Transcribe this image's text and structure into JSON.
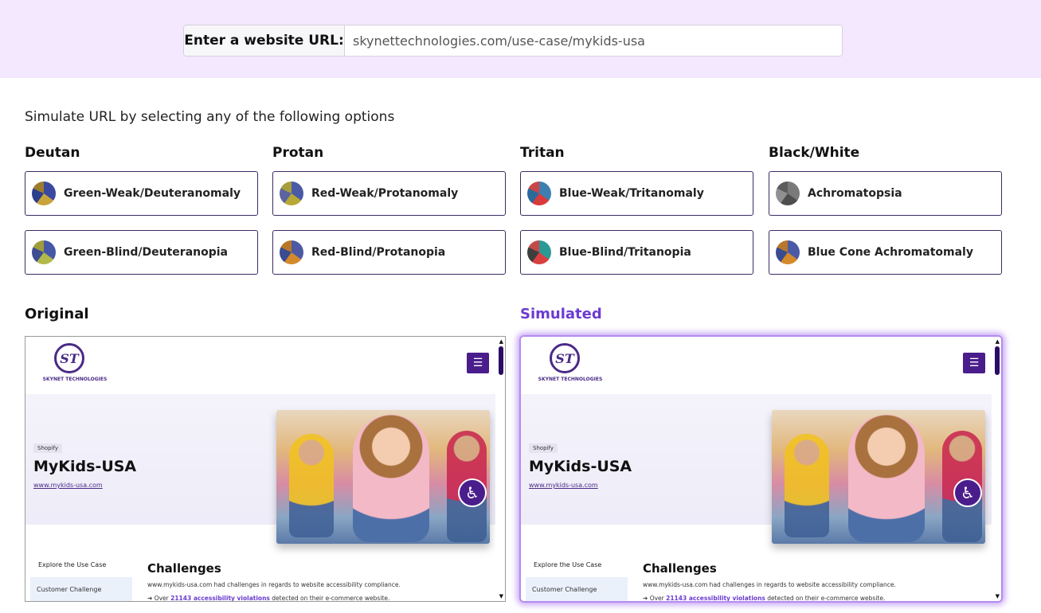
{
  "url_bar": {
    "label": "Enter a website URL:",
    "value": "skynettechnologies.com/use-case/mykids-usa"
  },
  "instructions": "Simulate URL by selecting any of the following options",
  "groups": [
    {
      "title": "Deutan",
      "options": [
        {
          "label": "Green-Weak/Deuteranomaly",
          "colors": [
            "#3b4aa0",
            "#c9a43a",
            "#2b3f8c",
            "#9d7c2e"
          ]
        },
        {
          "label": "Green-Blind/Deuteranopia",
          "colors": [
            "#4657a8",
            "#b3b84a",
            "#3c4d92",
            "#a09c3b"
          ]
        }
      ]
    },
    {
      "title": "Protan",
      "options": [
        {
          "label": "Red-Weak/Protanomaly",
          "colors": [
            "#4b5aa6",
            "#b8a835",
            "#5c64a0",
            "#a79d3c"
          ]
        },
        {
          "label": "Red-Blind/Protanopia",
          "colors": [
            "#4c5aa3",
            "#d4892b",
            "#3a4b8f",
            "#b7782c"
          ]
        }
      ]
    },
    {
      "title": "Tritan",
      "options": [
        {
          "label": "Blue-Weak/Tritanomaly",
          "colors": [
            "#3e7fb0",
            "#d93a3a",
            "#2c6a9c",
            "#c84646"
          ]
        },
        {
          "label": "Blue-Blind/Tritanopia",
          "colors": [
            "#2b9a95",
            "#d84040",
            "#3e3e3e",
            "#c14a4a"
          ]
        }
      ]
    },
    {
      "title": "Black/White",
      "options": [
        {
          "label": "Achromatopsia",
          "colors": [
            "#7a7a7a",
            "#4e4e4e",
            "#909090",
            "#5c5c5c"
          ]
        },
        {
          "label": "Blue Cone Achromatomaly",
          "colors": [
            "#4a5aa6",
            "#d4892b",
            "#3a4b8f",
            "#b7782c"
          ]
        }
      ]
    }
  ],
  "preview": {
    "original_title": "Original",
    "simulated_title": "Simulated",
    "logo_mark": "ST",
    "logo_text": "SKYNET TECHNOLOGIES",
    "menu_icon": "☰",
    "tag": "Shopify",
    "site_title": "MyKids-USA",
    "site_link": "www.mykids-usa.com",
    "accessibility_icon": "♿",
    "side_title": "Explore the Use Case",
    "side_item": "Customer Challenge",
    "challenges_title": "Challenges",
    "challenges_text": "www.mykids-usa.com had challenges in regards to website accessibility compliance.",
    "bullet_prefix": "Over ",
    "bullet_highlight": "21143 accessibility violations",
    "bullet_suffix": " detected on their e-commerce website.",
    "arrow_icon": "➔"
  },
  "colors": {
    "accent": "#6b3bd1",
    "topbar": "#f3e8fd",
    "border": "#3d2a66"
  }
}
